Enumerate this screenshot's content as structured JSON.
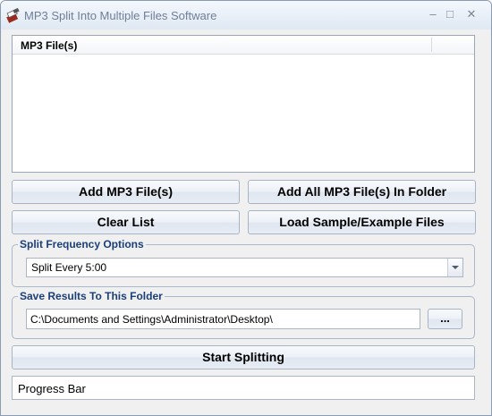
{
  "window": {
    "title": "MP3 Split Into Multiple Files Software",
    "minimize_glyph": "–",
    "maximize_glyph": "□",
    "close_glyph": "✕"
  },
  "file_list": {
    "column_header": "MP3 File(s)",
    "items": []
  },
  "buttons": {
    "add_files": "Add MP3 File(s)",
    "add_folder": "Add All MP3 File(s) In Folder",
    "clear_list": "Clear List",
    "load_sample": "Load Sample/Example Files",
    "start": "Start Splitting",
    "browse": "..."
  },
  "split_options": {
    "group_label": "Split Frequency Options",
    "selected": "Split Every 5:00"
  },
  "save_folder": {
    "group_label": "Save Results To This Folder",
    "path": "C:\\Documents and Settings\\Administrator\\Desktop\\"
  },
  "progress": {
    "label": "Progress Bar",
    "fraction": 0
  },
  "colors": {
    "group_label": "#1b3f7a",
    "window_bg": "#f0f0f0"
  },
  "icons": [
    "app-icon",
    "dropdown-arrow-icon"
  ]
}
